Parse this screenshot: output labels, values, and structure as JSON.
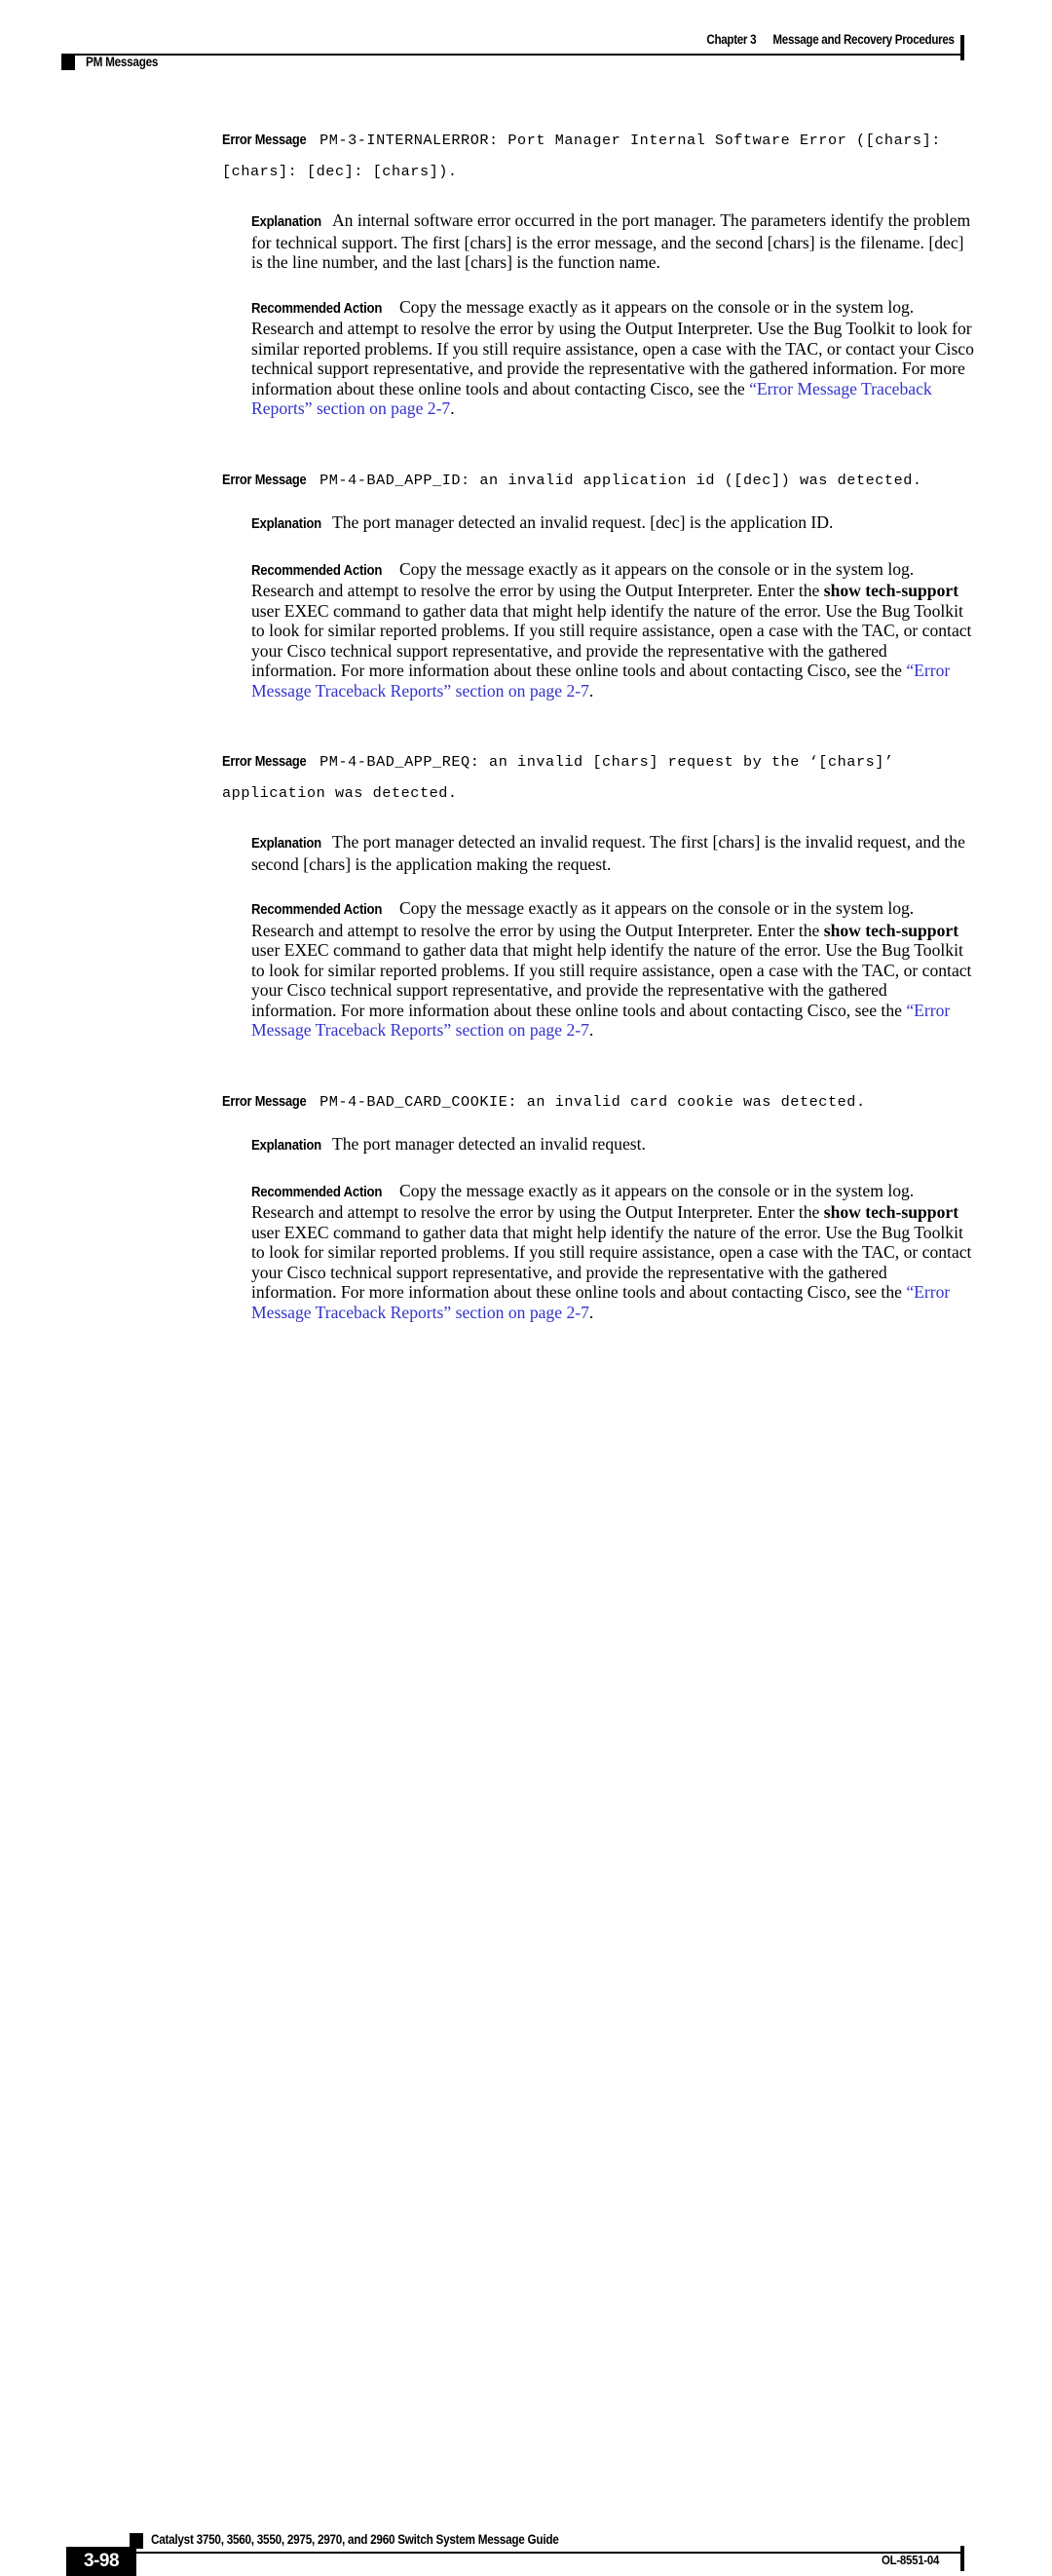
{
  "header": {
    "chapter_number": "Chapter 3",
    "chapter_title": "Message and Recovery Procedures",
    "section_title": "PM Messages"
  },
  "footer": {
    "page_number": "3-98",
    "document_title": "Catalyst 3750, 3560, 3550, 2975, 2970, and 2960 Switch System Message Guide",
    "document_id": "OL-8551-04"
  },
  "labels": {
    "error_message": "Error Message",
    "explanation": "Explanation",
    "recommended_action": "Recommended Action"
  },
  "link_color": "#3333cc",
  "messages": [
    {
      "id": "pm-3-internalerror",
      "code": "PM-3-INTERNALERROR: Port Manager Internal Software Error ([chars]: [chars]: [dec]: [chars]).",
      "explanation": "An internal software error occurred in the port manager. The parameters identify the problem for technical support. The first [chars] is the error message, and the second [chars] is the filename. [dec] is the line number, and the last [chars] is the function name.",
      "action_part1": "Copy the message exactly as it appears on the console or in the system log. Research and attempt to resolve the error by using the Output Interpreter. Use the Bug Toolkit to look for similar reported problems. If you still require assistance, open a case with the TAC, or contact your Cisco technical support representative, and provide the representative with the gathered information. For more information about these online tools and about contacting Cisco, see the ",
      "action_link": "“Error Message Traceback Reports” section on page 2-7",
      "action_tail": ".",
      "has_command": false
    },
    {
      "id": "pm-4-bad-app-id",
      "code": "PM-4-BAD_APP_ID: an invalid application id ([dec]) was detected.",
      "explanation": "The port manager detected an invalid request. [dec] is the application ID.",
      "action_part1": "Copy the message exactly as it appears on the console or in the system log. Research and attempt to resolve the error by using the Output Interpreter. Enter the ",
      "command": "show tech-support",
      "action_part2": " user EXEC command to gather data that might help identify the nature of the error. Use the Bug Toolkit to look for similar reported problems. If you still require assistance, open a case with the TAC, or contact your Cisco technical support representative, and provide the representative with the gathered information. For more information about these online tools and about contacting Cisco, see the ",
      "action_link": "“Error Message Traceback Reports” section on page 2-7",
      "action_tail": ".",
      "has_command": true
    },
    {
      "id": "pm-4-bad-app-req",
      "code": "PM-4-BAD_APP_REQ: an invalid [chars] request by the ‘[chars]’ application was detected.",
      "explanation": "The port manager detected an invalid request. The first [chars] is the invalid request, and the second [chars] is the application making the request.",
      "action_part1": "Copy the message exactly as it appears on the console or in the system log. Research and attempt to resolve the error by using the Output Interpreter. Enter the ",
      "command": "show tech-support",
      "action_part2": " user EXEC command to gather data that might help identify the nature of the error. Use the Bug Toolkit to look for similar reported problems. If you still require assistance, open a case with the TAC, or contact your Cisco technical support representative, and provide the representative with the gathered information. For more information about these online tools and about contacting Cisco, see the ",
      "action_link": "“Error Message Traceback Reports” section on page 2-7",
      "action_tail": ".",
      "has_command": true
    },
    {
      "id": "pm-4-bad-card-cookie",
      "code": "PM-4-BAD_CARD_COOKIE: an invalid card cookie was detected.",
      "explanation": "The port manager detected an invalid request.",
      "action_part1": "Copy the message exactly as it appears on the console or in the system log. Research and attempt to resolve the error by using the Output Interpreter. Enter the ",
      "command": "show tech-support",
      "action_part2": " user EXEC command to gather data that might help identify the nature of the error. Use the Bug Toolkit to look for similar reported problems. If you still require assistance, open a case with the TAC, or contact your Cisco technical support representative, and provide the representative with the gathered information. For more information about these online tools and about contacting Cisco, see the ",
      "action_link": "“Error Message Traceback Reports” section on page 2-7",
      "action_tail": ".",
      "has_command": true
    }
  ]
}
